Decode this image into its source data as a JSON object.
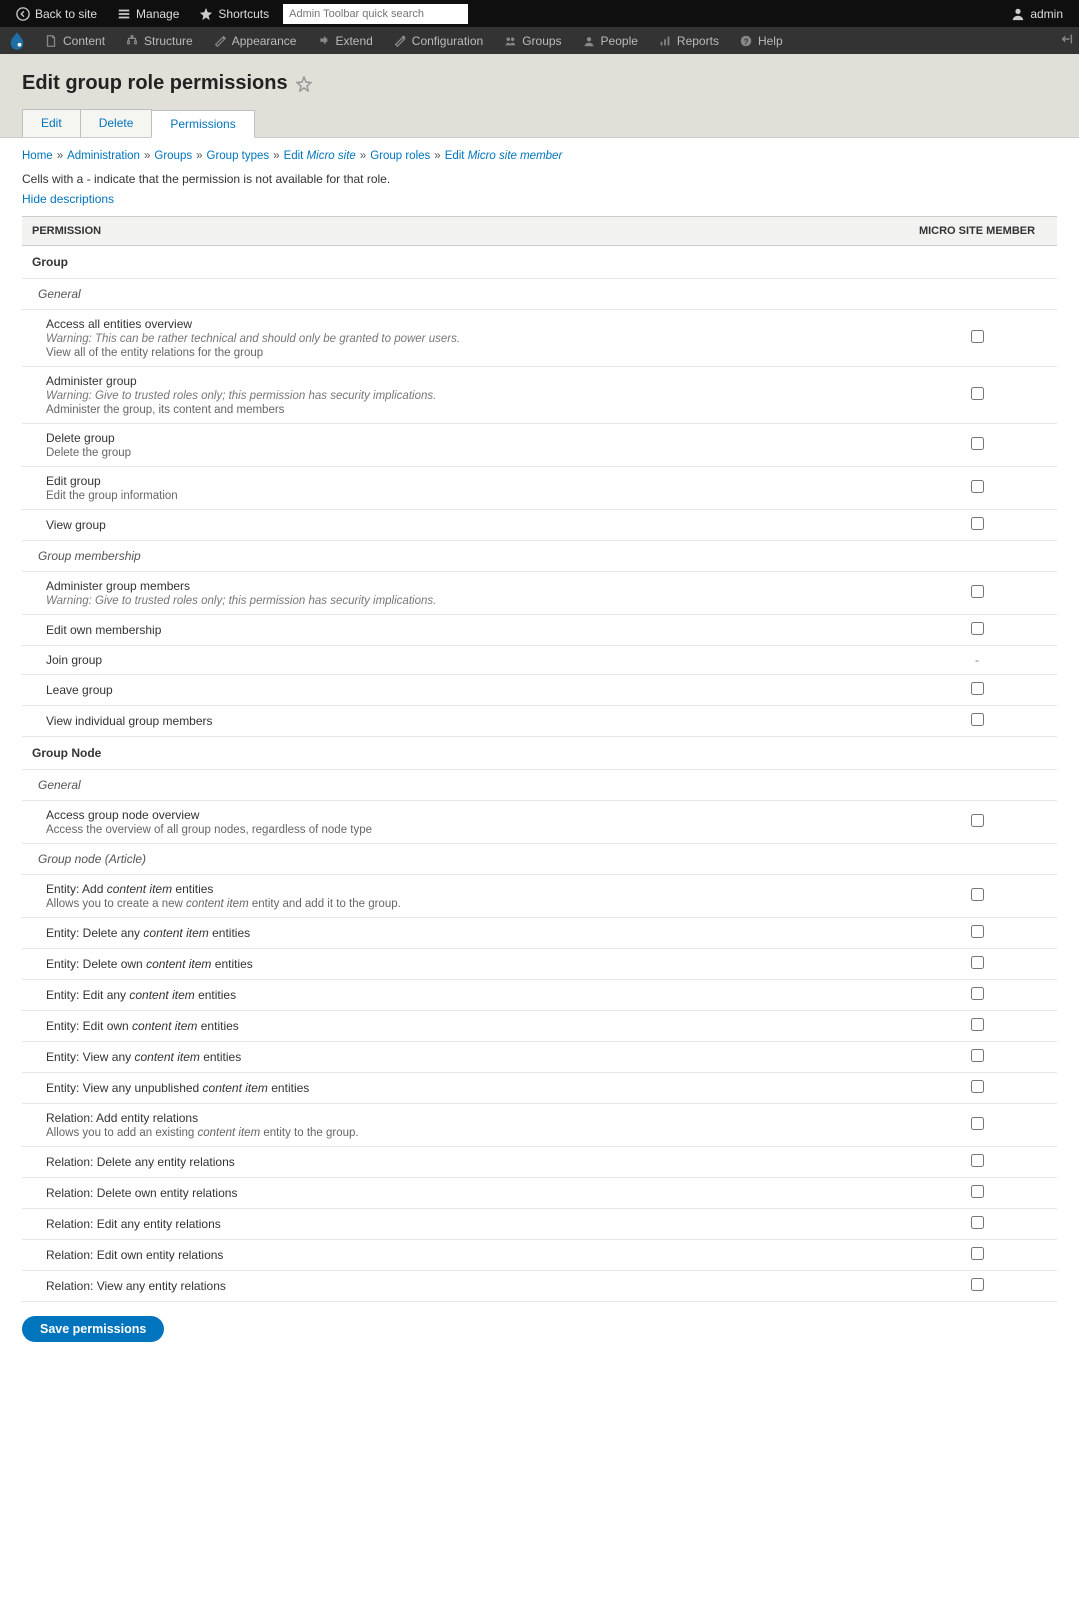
{
  "toolbar_top": {
    "back": "Back to site",
    "manage": "Manage",
    "shortcuts": "Shortcuts",
    "search_placeholder": "Admin Toolbar quick search",
    "user": "admin"
  },
  "toolbar_admin": {
    "items": [
      {
        "label": "Content"
      },
      {
        "label": "Structure"
      },
      {
        "label": "Appearance"
      },
      {
        "label": "Extend"
      },
      {
        "label": "Configuration"
      },
      {
        "label": "Groups"
      },
      {
        "label": "People"
      },
      {
        "label": "Reports"
      },
      {
        "label": "Help"
      }
    ]
  },
  "page": {
    "title": "Edit group role permissions",
    "tabs": [
      {
        "label": "Edit",
        "active": false
      },
      {
        "label": "Delete",
        "active": false
      },
      {
        "label": "Permissions",
        "active": true
      }
    ],
    "breadcrumb": [
      {
        "text": "Home"
      },
      {
        "text": "Administration"
      },
      {
        "text": "Groups"
      },
      {
        "text": "Group types"
      },
      {
        "text": "Edit ",
        "em": "Micro site"
      },
      {
        "text": "Group roles"
      },
      {
        "text": "Edit ",
        "em": "Micro site member"
      }
    ],
    "help": "Cells with a - indicate that the permission is not available for that role.",
    "hide_desc": "Hide descriptions",
    "th_permission": "PERMISSION",
    "th_role": "MICRO SITE MEMBER",
    "save": "Save permissions"
  },
  "perms": [
    {
      "type": "module",
      "label": "Group"
    },
    {
      "type": "section",
      "label": "General"
    },
    {
      "type": "perm",
      "title": "Access all entities overview",
      "warn": "Warning: This can be rather technical and should only be granted to power users.",
      "desc": "View all of the entity relations for the group",
      "cb": true
    },
    {
      "type": "perm",
      "title": "Administer group",
      "warn": "Warning: Give to trusted roles only; this permission has security implications.",
      "desc": "Administer the group, its content and members",
      "cb": true
    },
    {
      "type": "perm",
      "title": "Delete group",
      "desc": "Delete the group",
      "cb": true
    },
    {
      "type": "perm",
      "title": "Edit group",
      "desc": "Edit the group information",
      "cb": true
    },
    {
      "type": "perm",
      "title": "View group",
      "cb": true
    },
    {
      "type": "section",
      "label": "Group membership"
    },
    {
      "type": "perm",
      "title": "Administer group members",
      "warn": "Warning: Give to trusted roles only; this permission has security implications.",
      "cb": true
    },
    {
      "type": "perm",
      "title": "Edit own membership",
      "cb": true
    },
    {
      "type": "perm",
      "title": "Join group",
      "cb": false
    },
    {
      "type": "perm",
      "title": "Leave group",
      "cb": true
    },
    {
      "type": "perm",
      "title": "View individual group members",
      "cb": true
    },
    {
      "type": "module",
      "label": "Group Node"
    },
    {
      "type": "section",
      "label": "General"
    },
    {
      "type": "perm",
      "title": "Access group node overview",
      "desc": "Access the overview of all group nodes, regardless of node type",
      "cb": true
    },
    {
      "type": "section",
      "label": "Group node (Article)"
    },
    {
      "type": "perm",
      "title": "Entity: Add <em>content item</em> entities",
      "desc_html": "Allows you to create a new <em>content item</em> entity and add it to the group.",
      "cb": true
    },
    {
      "type": "perm",
      "title": "Entity: Delete any <em>content item</em> entities",
      "cb": true
    },
    {
      "type": "perm",
      "title": "Entity: Delete own <em>content item</em> entities",
      "cb": true
    },
    {
      "type": "perm",
      "title": "Entity: Edit any <em>content item</em> entities",
      "cb": true
    },
    {
      "type": "perm",
      "title": "Entity: Edit own <em>content item</em> entities",
      "cb": true
    },
    {
      "type": "perm",
      "title": "Entity: View any <em>content item</em> entities",
      "cb": true
    },
    {
      "type": "perm",
      "title": "Entity: View any unpublished <em>content item</em> entities",
      "cb": true
    },
    {
      "type": "perm",
      "title": "Relation: Add entity relations",
      "desc_html": "Allows you to add an existing <em>content item</em> entity to the group.",
      "cb": true
    },
    {
      "type": "perm",
      "title": "Relation: Delete any entity relations",
      "cb": true
    },
    {
      "type": "perm",
      "title": "Relation: Delete own entity relations",
      "cb": true
    },
    {
      "type": "perm",
      "title": "Relation: Edit any entity relations",
      "cb": true
    },
    {
      "type": "perm",
      "title": "Relation: Edit own entity relations",
      "cb": true
    },
    {
      "type": "perm",
      "title": "Relation: View any entity relations",
      "cb": true
    }
  ]
}
